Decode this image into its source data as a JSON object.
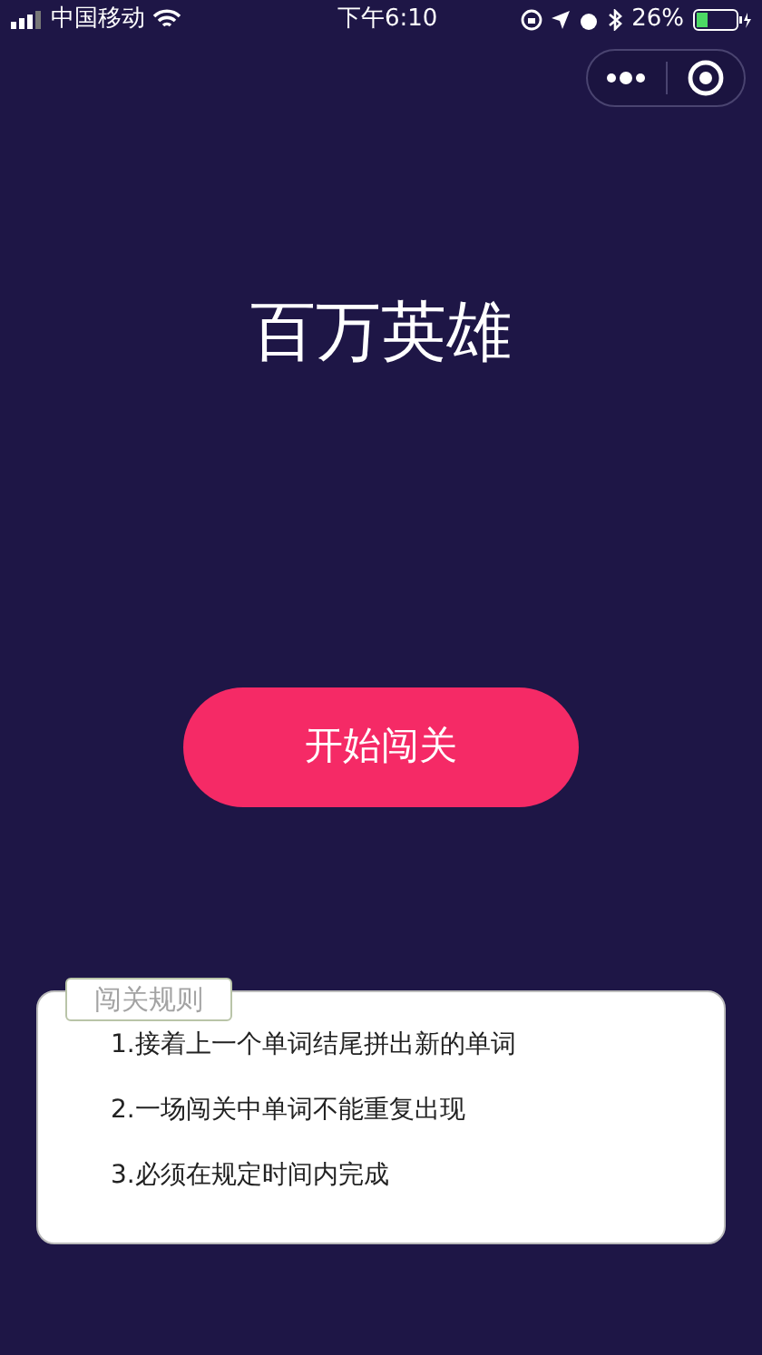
{
  "status_bar": {
    "carrier": "中国移动",
    "time": "下午6:10",
    "battery": "26%"
  },
  "title": "百万英雄",
  "start_button": "开始闯关",
  "rules": {
    "tab": "闯关规则",
    "items": [
      "1.接着上一个单词结尾拼出新的单词",
      "2.一场闯关中单词不能重复出现",
      "3.必须在规定时间内完成"
    ]
  }
}
